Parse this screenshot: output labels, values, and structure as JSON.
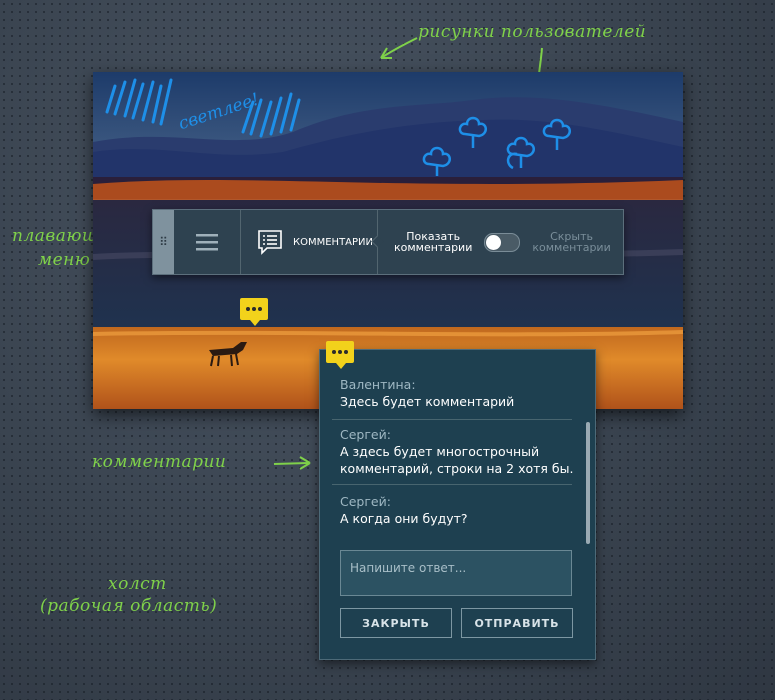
{
  "annotations": {
    "user_drawings": "рисунки пользователей",
    "floating_menu_line1": "плавающее",
    "floating_menu_line2": "меню",
    "comments": "комментарии",
    "canvas_line1": "холст",
    "canvas_line2": "(рабочая область)"
  },
  "drawing_text": "светлее!",
  "menu": {
    "comments_label": "КОММЕНТАРИИ",
    "show_comments_line1": "Показать",
    "show_comments_line2": "комментарии",
    "hide_comments_line1": "Скрыть",
    "hide_comments_line2": "комментарии",
    "toggle_state": "off"
  },
  "comments": [
    {
      "author": "Валентина:",
      "lines": [
        "Здесь будет комментарий"
      ]
    },
    {
      "author": "Сергей:",
      "lines": [
        "А здесь будет многострочный",
        "комментарий, строки на 2 хотя бы."
      ]
    },
    {
      "author": "Сергей:",
      "lines": [
        "А когда они будут?"
      ]
    }
  ],
  "reply": {
    "placeholder": "Напишите ответ..."
  },
  "buttons": {
    "close": "ЗАКРЫТЬ",
    "send": "ОТПРАВИТЬ"
  },
  "colors": {
    "accent_green": "#7fd14a",
    "marker_yellow": "#f2d21b",
    "drawing_blue": "#1e8fe8",
    "panel_bg": "#1e4050"
  },
  "icons": [
    "grip-icon",
    "hamburger-icon",
    "comments-list-icon",
    "comment-marker-icon",
    "tree-icon"
  ]
}
